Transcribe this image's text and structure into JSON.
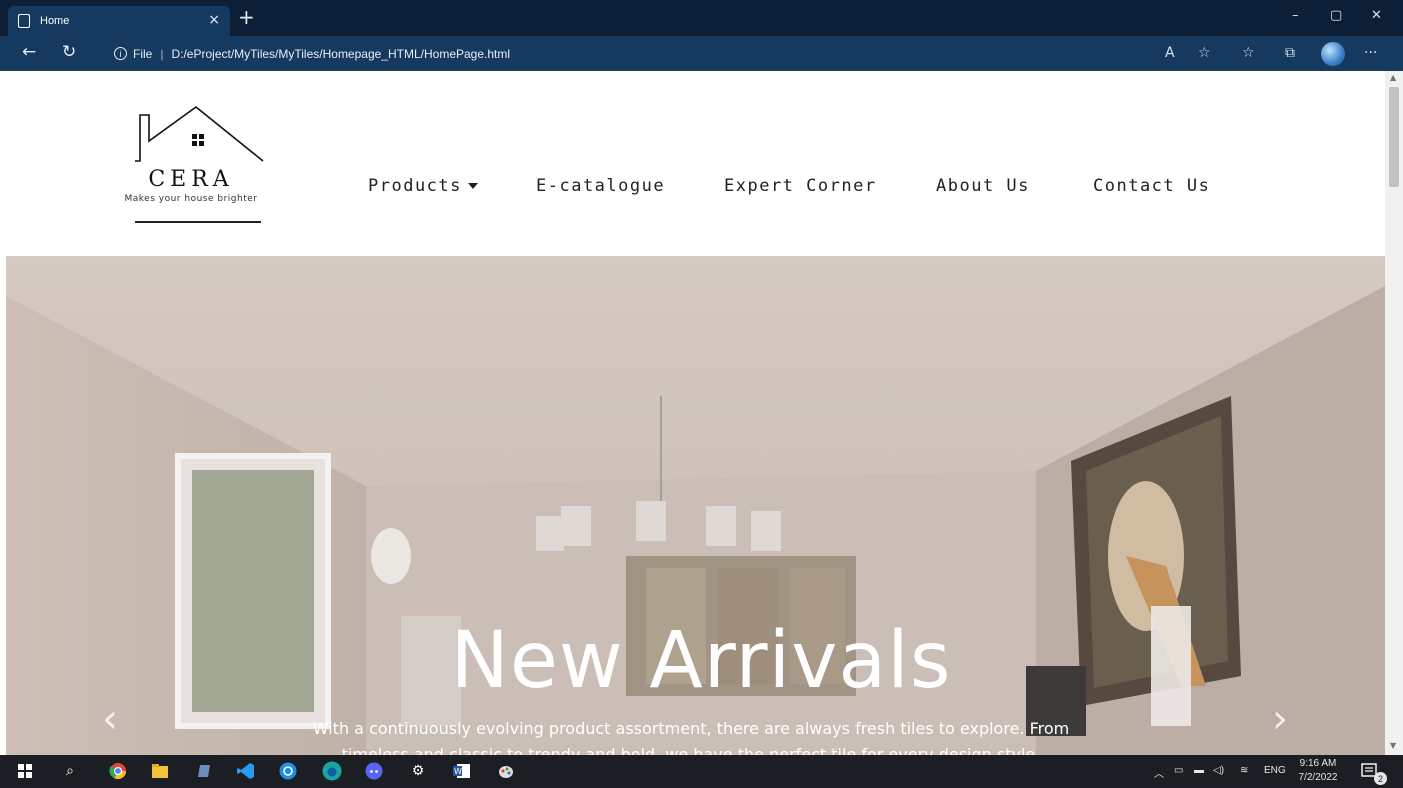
{
  "browser": {
    "tab_title": "Home",
    "tab_close": "×",
    "new_tab": "+",
    "url_scheme": "File",
    "url_path": "D:/eProject/MyTiles/MyTiles/Homepage_HTML/HomePage.html",
    "window_minimize": "–",
    "window_restore": "▢",
    "window_close": "✕"
  },
  "site": {
    "brand": "CERA",
    "tagline": "Makes your house brighter",
    "nav": [
      {
        "label": "Products"
      },
      {
        "label": "E-catalogue"
      },
      {
        "label": "Expert Corner"
      },
      {
        "label": "About Us"
      },
      {
        "label": "Contact Us"
      }
    ]
  },
  "hero": {
    "title": "New Arrivals",
    "text": "With a continuously evolving product assortment, there are always fresh tiles to explore. From timeless and classic to trendy and bold, we have the perfect tile for every design style.",
    "prev": "‹",
    "next": "›"
  },
  "taskbar": {
    "lang": "ENG",
    "time": "9:16 AM",
    "date": "7/2/2022",
    "notifications": "2"
  },
  "colors": {
    "chrome_dark": "#0c1f36",
    "chrome": "#163a5f",
    "taskbar": "#1b1f24"
  }
}
